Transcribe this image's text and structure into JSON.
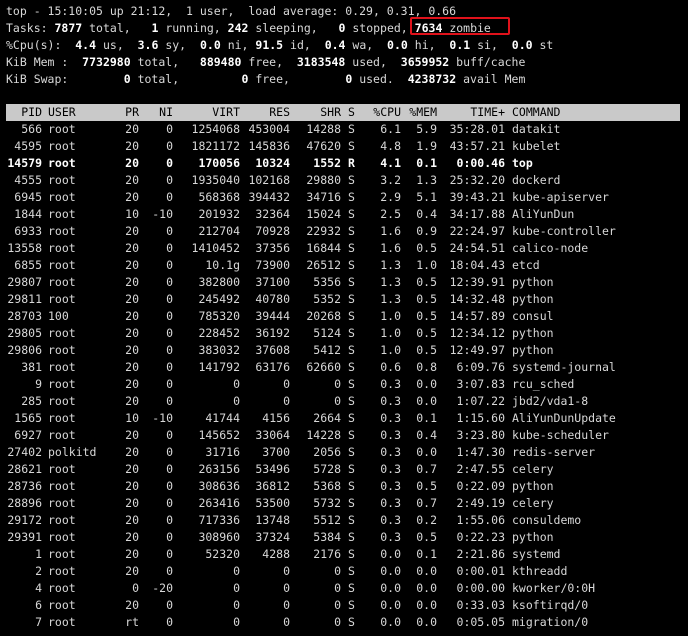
{
  "summary": {
    "top": "top - 15:10:05 up 21:12,  1 user,  load average: 0.29, 0.31, 0.66",
    "tasks": {
      "label": "Tasks:",
      "total": "7877",
      "total_label": "total,",
      "running": "1",
      "running_label": "running,",
      "sleeping": "242",
      "sleeping_label": "sleeping,",
      "stopped": "0",
      "stopped_label": "stopped,",
      "zombie": "7634",
      "zombie_label": "zombie"
    },
    "cpu": {
      "label": "%Cpu(s):",
      "us": "4.4",
      "us_label": "us,",
      "sy": "3.6",
      "sy_label": "sy,",
      "ni": "0.0",
      "ni_label": "ni,",
      "id": "91.5",
      "id_label": "id,",
      "wa": "0.4",
      "wa_label": "wa,",
      "hi": "0.0",
      "hi_label": "hi,",
      "si": "0.1",
      "si_label": "si,",
      "st": "0.0",
      "st_label": "st"
    },
    "mem": {
      "label": "KiB Mem :",
      "total": "7732980",
      "total_label": "total,",
      "free": "889480",
      "free_label": "free,",
      "used": "3183548",
      "used_label": "used,",
      "cache": "3659952",
      "cache_label": "buff/cache"
    },
    "swap": {
      "label": "KiB Swap:",
      "total": "0",
      "total_label": "total,",
      "free": "0",
      "free_label": "free,",
      "used": "0",
      "used_label": "used.",
      "avail": "4238732",
      "avail_label": "avail Mem"
    }
  },
  "columns": [
    "PID",
    "USER",
    "PR",
    "NI",
    "VIRT",
    "RES",
    "SHR",
    "S",
    "%CPU",
    "%MEM",
    "TIME+",
    "COMMAND"
  ],
  "processes": [
    [
      "566",
      "root",
      "20",
      "0",
      "1254068",
      "453004",
      "14288",
      "S",
      "6.1",
      "5.9",
      "35:28.01",
      "datakit"
    ],
    [
      "4595",
      "root",
      "20",
      "0",
      "1821172",
      "145836",
      "47620",
      "S",
      "4.8",
      "1.9",
      "43:57.21",
      "kubelet"
    ],
    [
      "14579",
      "root",
      "20",
      "0",
      "170056",
      "10324",
      "1552",
      "R",
      "4.1",
      "0.1",
      "0:00.46",
      "top"
    ],
    [
      "4555",
      "root",
      "20",
      "0",
      "1935040",
      "102168",
      "29880",
      "S",
      "3.2",
      "1.3",
      "25:32.20",
      "dockerd"
    ],
    [
      "6945",
      "root",
      "20",
      "0",
      "568368",
      "394432",
      "34716",
      "S",
      "2.9",
      "5.1",
      "39:43.21",
      "kube-apiserver"
    ],
    [
      "1844",
      "root",
      "10",
      "-10",
      "201932",
      "32364",
      "15024",
      "S",
      "2.5",
      "0.4",
      "34:17.88",
      "AliYunDun"
    ],
    [
      "6933",
      "root",
      "20",
      "0",
      "212704",
      "70928",
      "22932",
      "S",
      "1.6",
      "0.9",
      "22:24.97",
      "kube-controller"
    ],
    [
      "13558",
      "root",
      "20",
      "0",
      "1410452",
      "37356",
      "16844",
      "S",
      "1.6",
      "0.5",
      "24:54.51",
      "calico-node"
    ],
    [
      "6855",
      "root",
      "20",
      "0",
      "10.1g",
      "73900",
      "26512",
      "S",
      "1.3",
      "1.0",
      "18:04.43",
      "etcd"
    ],
    [
      "29807",
      "root",
      "20",
      "0",
      "382800",
      "37100",
      "5356",
      "S",
      "1.3",
      "0.5",
      "12:39.91",
      "python"
    ],
    [
      "29811",
      "root",
      "20",
      "0",
      "245492",
      "40780",
      "5352",
      "S",
      "1.3",
      "0.5",
      "14:32.48",
      "python"
    ],
    [
      "28703",
      "100",
      "20",
      "0",
      "785320",
      "39444",
      "20268",
      "S",
      "1.0",
      "0.5",
      "14:57.89",
      "consul"
    ],
    [
      "29805",
      "root",
      "20",
      "0",
      "228452",
      "36192",
      "5124",
      "S",
      "1.0",
      "0.5",
      "12:34.12",
      "python"
    ],
    [
      "29806",
      "root",
      "20",
      "0",
      "383032",
      "37608",
      "5412",
      "S",
      "1.0",
      "0.5",
      "12:49.97",
      "python"
    ],
    [
      "381",
      "root",
      "20",
      "0",
      "141792",
      "63176",
      "62660",
      "S",
      "0.6",
      "0.8",
      "6:09.76",
      "systemd-journal"
    ],
    [
      "9",
      "root",
      "20",
      "0",
      "0",
      "0",
      "0",
      "S",
      "0.3",
      "0.0",
      "3:07.83",
      "rcu_sched"
    ],
    [
      "285",
      "root",
      "20",
      "0",
      "0",
      "0",
      "0",
      "S",
      "0.3",
      "0.0",
      "1:07.22",
      "jbd2/vda1-8"
    ],
    [
      "1565",
      "root",
      "10",
      "-10",
      "41744",
      "4156",
      "2664",
      "S",
      "0.3",
      "0.1",
      "1:15.60",
      "AliYunDunUpdate"
    ],
    [
      "6927",
      "root",
      "20",
      "0",
      "145652",
      "33064",
      "14228",
      "S",
      "0.3",
      "0.4",
      "3:23.80",
      "kube-scheduler"
    ],
    [
      "27402",
      "polkitd",
      "20",
      "0",
      "31716",
      "3700",
      "2056",
      "S",
      "0.3",
      "0.0",
      "1:47.30",
      "redis-server"
    ],
    [
      "28621",
      "root",
      "20",
      "0",
      "263156",
      "53496",
      "5728",
      "S",
      "0.3",
      "0.7",
      "2:47.55",
      "celery"
    ],
    [
      "28736",
      "root",
      "20",
      "0",
      "308636",
      "36812",
      "5368",
      "S",
      "0.3",
      "0.5",
      "0:22.09",
      "python"
    ],
    [
      "28896",
      "root",
      "20",
      "0",
      "263416",
      "53500",
      "5732",
      "S",
      "0.3",
      "0.7",
      "2:49.19",
      "celery"
    ],
    [
      "29172",
      "root",
      "20",
      "0",
      "717336",
      "13748",
      "5512",
      "S",
      "0.3",
      "0.2",
      "1:55.06",
      "consuldemo"
    ],
    [
      "29391",
      "root",
      "20",
      "0",
      "308960",
      "37324",
      "5384",
      "S",
      "0.3",
      "0.5",
      "0:22.23",
      "python"
    ],
    [
      "1",
      "root",
      "20",
      "0",
      "52320",
      "4288",
      "2176",
      "S",
      "0.0",
      "0.1",
      "2:21.86",
      "systemd"
    ],
    [
      "2",
      "root",
      "20",
      "0",
      "0",
      "0",
      "0",
      "S",
      "0.0",
      "0.0",
      "0:00.01",
      "kthreadd"
    ],
    [
      "4",
      "root",
      "0",
      "-20",
      "0",
      "0",
      "0",
      "S",
      "0.0",
      "0.0",
      "0:00.00",
      "kworker/0:0H"
    ],
    [
      "6",
      "root",
      "20",
      "0",
      "0",
      "0",
      "0",
      "S",
      "0.0",
      "0.0",
      "0:33.03",
      "ksoftirqd/0"
    ],
    [
      "7",
      "root",
      "rt",
      "0",
      "0",
      "0",
      "0",
      "S",
      "0.0",
      "0.0",
      "0:05.05",
      "migration/0"
    ]
  ],
  "highlight": {
    "color": "#e0121b"
  }
}
